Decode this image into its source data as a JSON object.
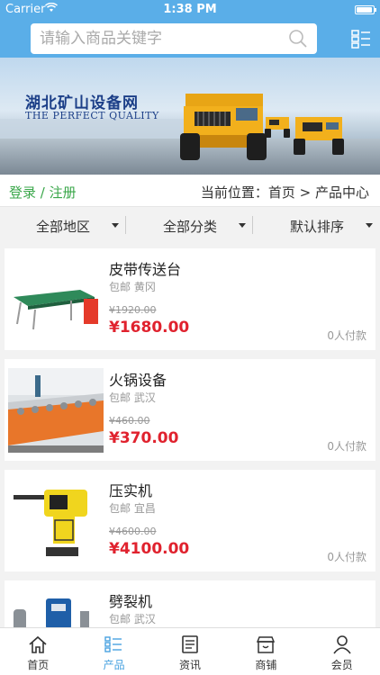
{
  "status": {
    "carrier": "Carrier",
    "time": "1:38 PM",
    "battery_level": 0.95
  },
  "search": {
    "placeholder": "请输入商品关键字"
  },
  "banner": {
    "title": "湖北矿山设备网",
    "subtitle": "THE PERFECT QUALITY"
  },
  "location_bar": {
    "login": "登录 / 注册",
    "location": "当前位置：首页 > 产品中心"
  },
  "filters": [
    {
      "label": "全部地区"
    },
    {
      "label": "全部分类"
    },
    {
      "label": "默认排序"
    }
  ],
  "products": [
    {
      "name": "皮带传送台",
      "meta": "包邮 黄冈",
      "original_price": "¥1920.00",
      "price": "¥1680.00",
      "sold": "0人付款",
      "icon": "conveyor-belt-image"
    },
    {
      "name": "火锅设备",
      "meta": "包邮 武汉",
      "original_price": "¥460.00",
      "price": "¥370.00",
      "sold": "0人付款",
      "icon": "hotpot-equipment-image"
    },
    {
      "name": "压实机",
      "meta": "包邮 宜昌",
      "original_price": "¥4600.00",
      "price": "¥4100.00",
      "sold": "0人付款",
      "icon": "rammer-compactor-image"
    },
    {
      "name": "劈裂机",
      "meta": "包邮 武汉",
      "original_price": "",
      "price": "",
      "sold": "",
      "icon": "splitting-machine-image"
    }
  ],
  "tabbar": [
    {
      "label": "首页",
      "icon": "home-icon"
    },
    {
      "label": "产品",
      "icon": "products-list-icon",
      "active": true
    },
    {
      "label": "资讯",
      "icon": "news-icon"
    },
    {
      "label": "商铺",
      "icon": "store-icon"
    },
    {
      "label": "会员",
      "icon": "member-icon"
    }
  ],
  "colors": {
    "header": "#5aaee8",
    "accent_green": "#3aa74a",
    "price_red": "#e0222e",
    "tab_active": "#4aa3e0"
  }
}
